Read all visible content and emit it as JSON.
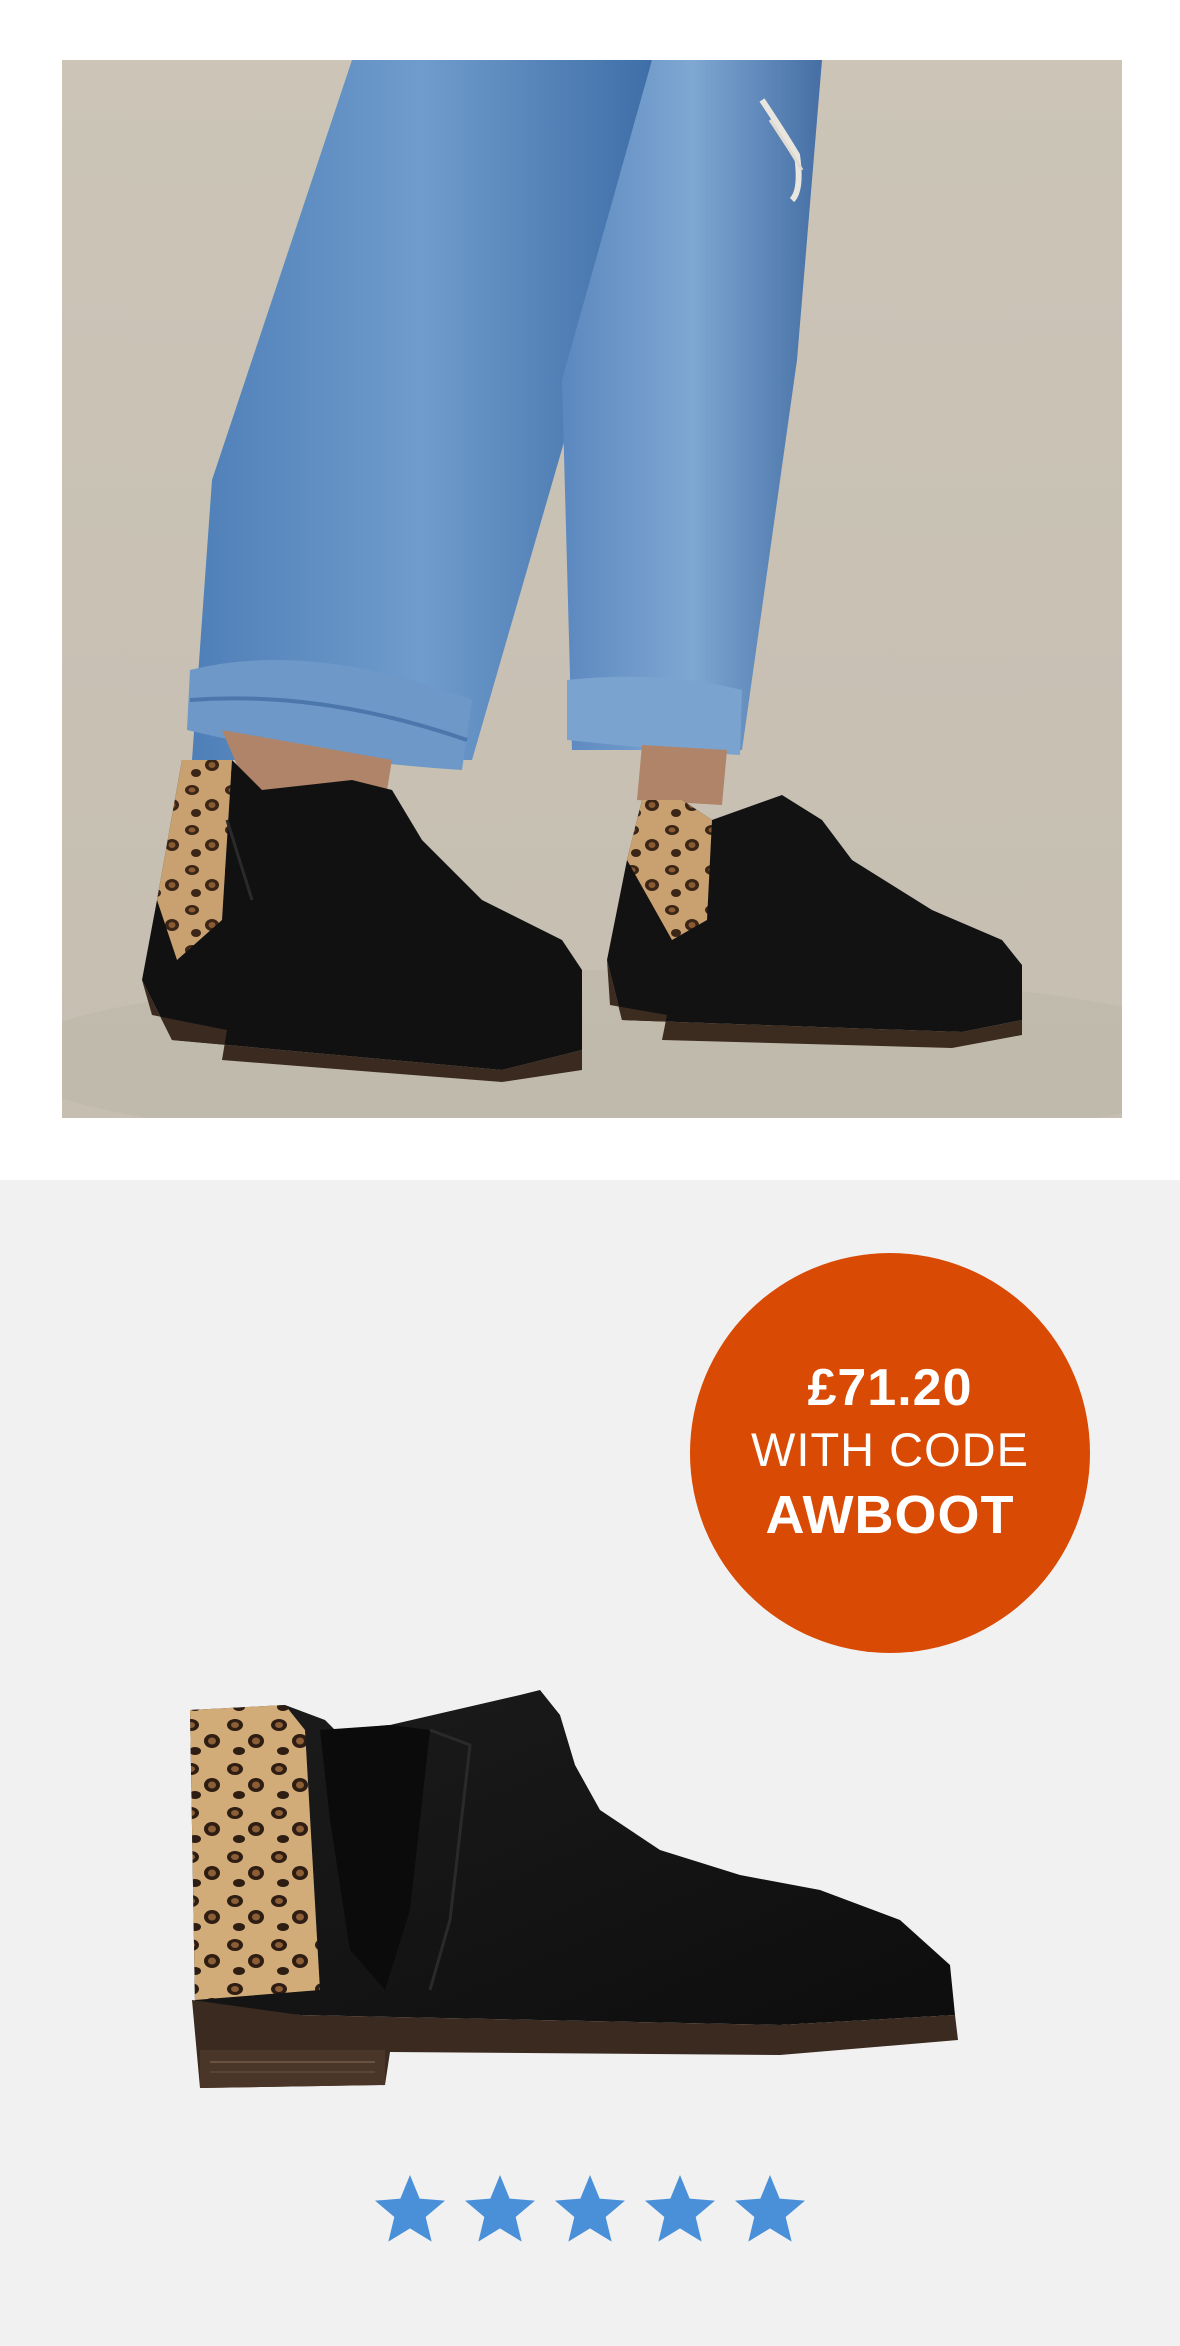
{
  "hero_image": {
    "alt": "Model wearing black suede Chelsea boots with leopard print heel panels and cuffed jeans"
  },
  "product_image": {
    "alt": "Black suede Chelsea boot with leopard print heel panel"
  },
  "promo_badge": {
    "price": "£71.20",
    "with_code": "WITH CODE",
    "code": "AWBOOT",
    "color": "#d94a04"
  },
  "rating": {
    "stars": 5,
    "max_stars": 5,
    "star_color": "#4a90d9",
    "icon": "star-icon"
  }
}
